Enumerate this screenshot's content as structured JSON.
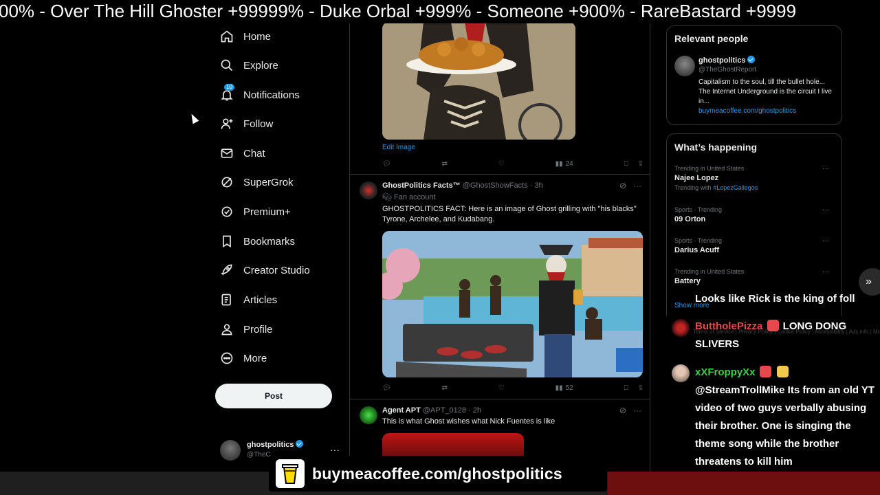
{
  "ticker": {
    "text": "00%  -  Over The Hill Ghoster +99999%  -  Duke Orbal +999%  -  Someone +900% - RareBastard +9999"
  },
  "nav": {
    "items": [
      {
        "label": "Home",
        "icon": "home-icon"
      },
      {
        "label": "Explore",
        "icon": "search-icon"
      },
      {
        "label": "Notifications",
        "icon": "bell-icon",
        "badge": "10"
      },
      {
        "label": "Follow",
        "icon": "person-add-icon"
      },
      {
        "label": "Chat",
        "icon": "mail-icon"
      },
      {
        "label": "SuperGrok",
        "icon": "grok-icon"
      },
      {
        "label": "Premium+",
        "icon": "verified-badge-icon"
      },
      {
        "label": "Bookmarks",
        "icon": "bookmark-icon"
      },
      {
        "label": "Creator Studio",
        "icon": "rocket-icon"
      },
      {
        "label": "Articles",
        "icon": "article-icon"
      },
      {
        "label": "Profile",
        "icon": "person-icon"
      },
      {
        "label": "More",
        "icon": "more-circle-icon"
      }
    ],
    "post_label": "Post",
    "account": {
      "name": "ghostpolitics",
      "handle": "@TheC..."
    }
  },
  "feed": {
    "tweet1": {
      "edit_image": "Edit Image",
      "views": "24"
    },
    "tweet2": {
      "name": "GhostPolitics Facts™",
      "handle_time": "@GhostShowFacts · 3h",
      "label": "Fan account",
      "text": "GHOSTPOLITICS FACT: Here is an image of Ghost grilling with \"his blacks\" Tyrone, Archelee, and Kudabang.",
      "views": "52"
    },
    "tweet3": {
      "name": "Agent APT",
      "handle_time": "@APT_0128 · 2h",
      "text": "This is what Ghost wishes what Nick Fuentes is like"
    }
  },
  "sidebar": {
    "relevant": {
      "title": "Relevant people",
      "name": "ghostpolitics",
      "handle": "@TheGhostReport",
      "bio": "Capitalism to the soul, till the bullet hole... The Internet Underground is the circuit I live in...",
      "link": "buymeacoffee.com/ghostpolitics"
    },
    "happening": {
      "title": "What’s happening",
      "trends": [
        {
          "context": "Trending in United States",
          "topic": "Najee Lopez",
          "with_label": "Trending with ",
          "with_tag": "#LopezGallegos"
        },
        {
          "context": "Sports · Trending",
          "topic": "09 Orton"
        },
        {
          "context": "Sports · Trending",
          "topic": "Darius Acuff"
        },
        {
          "context": "Trending in United States",
          "topic": "Battery"
        }
      ],
      "show_more": "Show more"
    },
    "footer": "Terms of Service  |  Privacy Policy  |  Cookie Policy  |  Accessibility  |  Ads info  |  More ···  © 2026 X Corp."
  },
  "chat": {
    "partial": "Looks like Rick is the king of foll",
    "msg1": {
      "user": "ButtholePizza",
      "text": " LONG DONG SLIVERS"
    },
    "msg2": {
      "user": "xXFroppyXx",
      "mention": "@StreamTrollMike",
      "text": " Its from an old YT video of two guys verbally abusing their brother. One is singing the theme song while the brother threatens to kill him"
    }
  },
  "overlay": {
    "coffee": "buymeacoffee.com/ghostpolitics",
    "arrow": "»"
  },
  "colors": {
    "accent": "#1d9bf0",
    "chat_user1": "#e5484d",
    "chat_user2": "#3ecf4a"
  }
}
